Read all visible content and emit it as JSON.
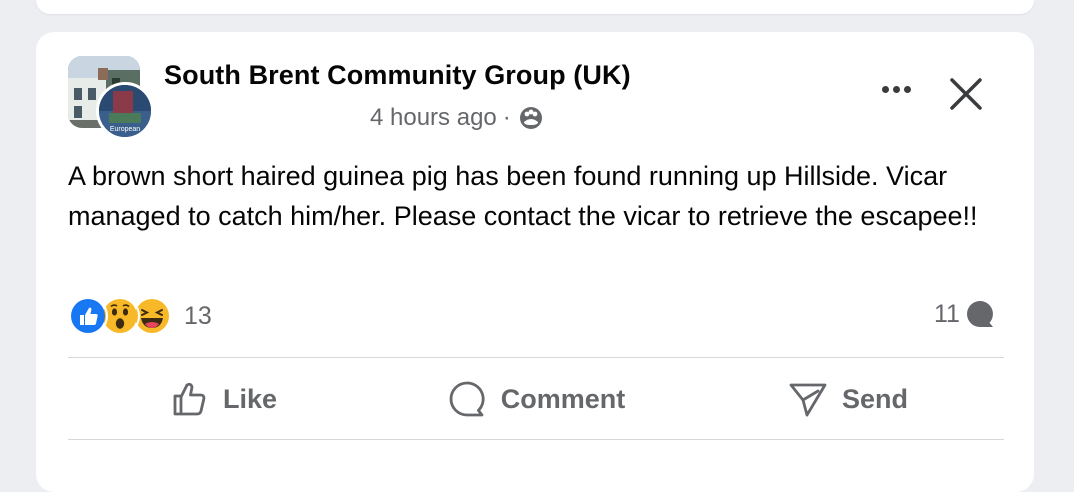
{
  "post": {
    "group_name": "South Brent Community Group (UK)",
    "time_ago": "4 hours ago",
    "separator": "·",
    "privacy_icon": "group-audience-icon",
    "avatar_badge_text": "European",
    "body": "A brown short haired guinea pig has been found running up Hillside. Vicar managed to catch him/her. Please contact the vicar to retrieve the escapee!!"
  },
  "reactions": {
    "icons": [
      "like-reaction-icon",
      "wow-reaction-icon",
      "haha-reaction-icon"
    ],
    "count": "13"
  },
  "comments": {
    "count": "11",
    "icon": "comment-bubble-icon"
  },
  "actions": {
    "like_label": "Like",
    "comment_label": "Comment",
    "send_label": "Send"
  },
  "colors": {
    "like_blue": "#1877f2",
    "reaction_yellow": "#f7b928",
    "text_primary": "#050505",
    "text_secondary": "#65676b"
  }
}
